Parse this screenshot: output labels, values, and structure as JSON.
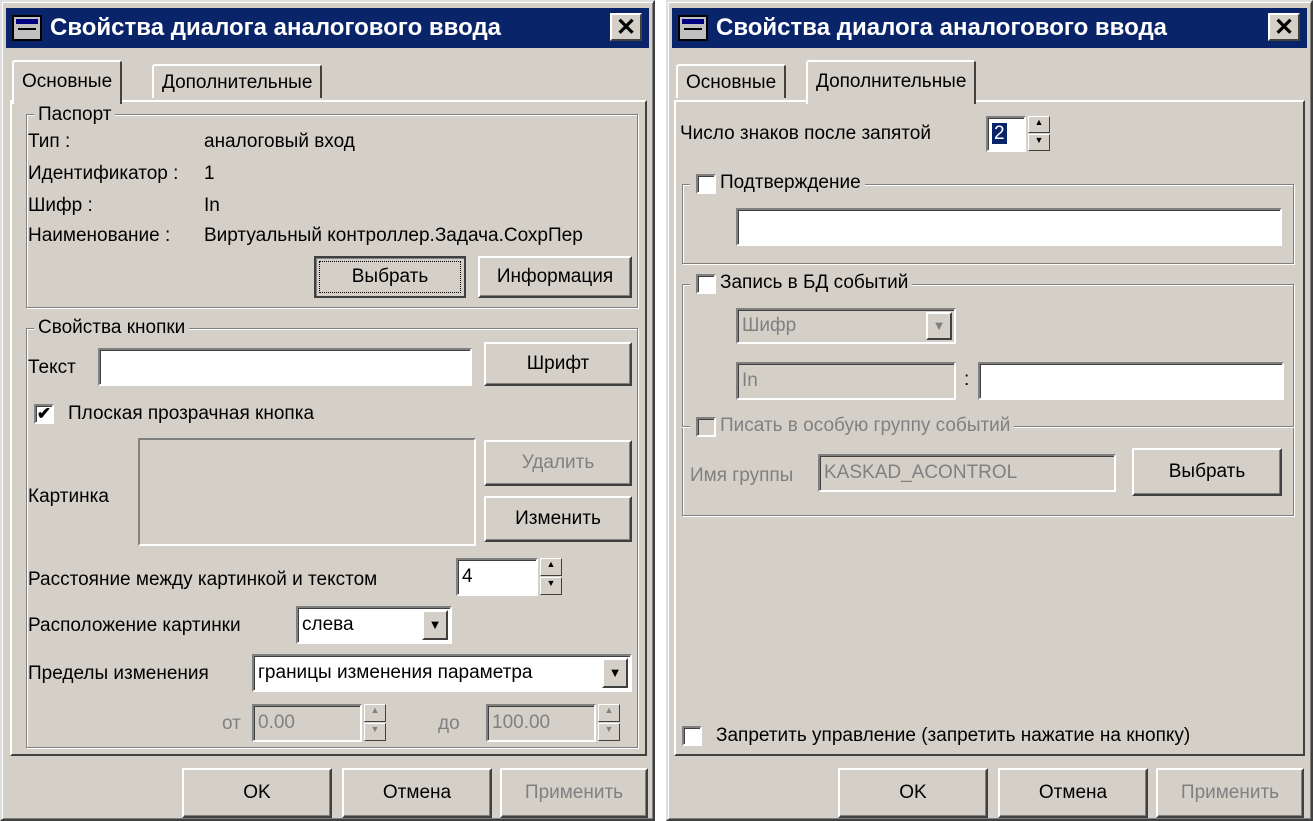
{
  "left_dialog": {
    "title": "Свойства диалога аналогового ввода",
    "close_label": "✕",
    "tabs": [
      "Основные",
      "Дополнительные"
    ],
    "passport": {
      "legend": "Паспорт",
      "type_label": "Тип :",
      "type_value": "аналоговый вход",
      "id_label": "Идентификатор :",
      "id_value": "1",
      "cipher_label": "Шифр :",
      "cipher_value": "In",
      "name_label": "Наименование :",
      "name_value": "Виртуальный контроллер.Задача.СохрПер",
      "select_button": "Выбрать",
      "info_button": "Информация"
    },
    "button_props": {
      "legend": "Свойства кнопки",
      "text_label": "Текст",
      "text_value": "",
      "font_button": "Шрифт",
      "flat_checkbox_label": "Плоская прозрачная кнопка",
      "flat_checked": true,
      "picture_label": "Картинка",
      "delete_button": "Удалить",
      "change_button": "Изменить",
      "spacing_label": "Расстояние между картинкой и текстом",
      "spacing_value": "4",
      "position_label": "Расположение картинки",
      "position_value": "слева",
      "limits_label": "Пределы изменения",
      "limits_value": "границы изменения параметра",
      "from_label": "от",
      "from_value": "0.00",
      "to_label": "до",
      "to_value": "100.00"
    },
    "footer": {
      "ok": "OK",
      "cancel": "Отмена",
      "apply": "Применить"
    }
  },
  "right_dialog": {
    "title": "Свойства диалога аналогового ввода",
    "close_label": "✕",
    "tabs": [
      "Основные",
      "Дополнительные"
    ],
    "decimals_label": "Число знаков после запятой",
    "decimals_value": "2",
    "confirm": {
      "label": "Подтверждение",
      "checked": false,
      "value": ""
    },
    "event_db": {
      "label": "Запись в БД событий",
      "checked": false,
      "field_value": "Шифр",
      "cipher_value": "In",
      "separator": ":",
      "extra_value": "",
      "special_group_label": "Писать в особую группу событий",
      "group_name_label": "Имя группы",
      "group_name_value": "KASKAD_ACONTROL",
      "select_button": "Выбрать"
    },
    "forbid_label": "Запретить управление (запретить нажатие на кнопку)",
    "forbid_checked": false,
    "footer": {
      "ok": "OK",
      "cancel": "Отмена",
      "apply": "Применить"
    }
  }
}
